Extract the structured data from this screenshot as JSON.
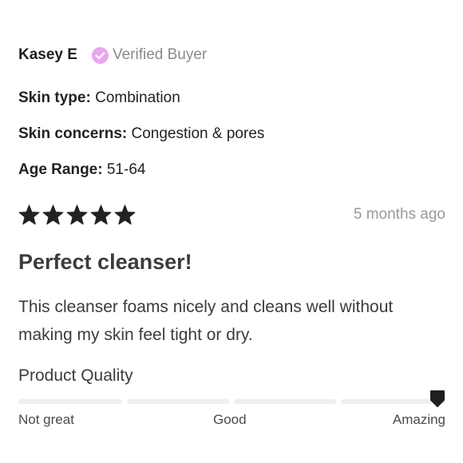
{
  "reviewer": {
    "name": "Kasey E",
    "badge_label": "Verified Buyer",
    "badge_color": "#e9a6f0"
  },
  "attributes": [
    {
      "key": "Skin type:",
      "value": "Combination"
    },
    {
      "key": "Skin concerns:",
      "value": "Congestion & pores"
    },
    {
      "key": "Age Range:",
      "value": "51-64"
    }
  ],
  "rating": {
    "stars": 5,
    "max": 5,
    "star_color": "#222222"
  },
  "timestamp": "5 months ago",
  "review": {
    "title": "Perfect cleanser!",
    "body": "This cleanser foams nicely and cleans well without making my skin feel tight or dry."
  },
  "product_quality": {
    "heading": "Product Quality",
    "level": 1.0,
    "scale_labels": [
      "Not great",
      "Good",
      "Amazing"
    ]
  }
}
